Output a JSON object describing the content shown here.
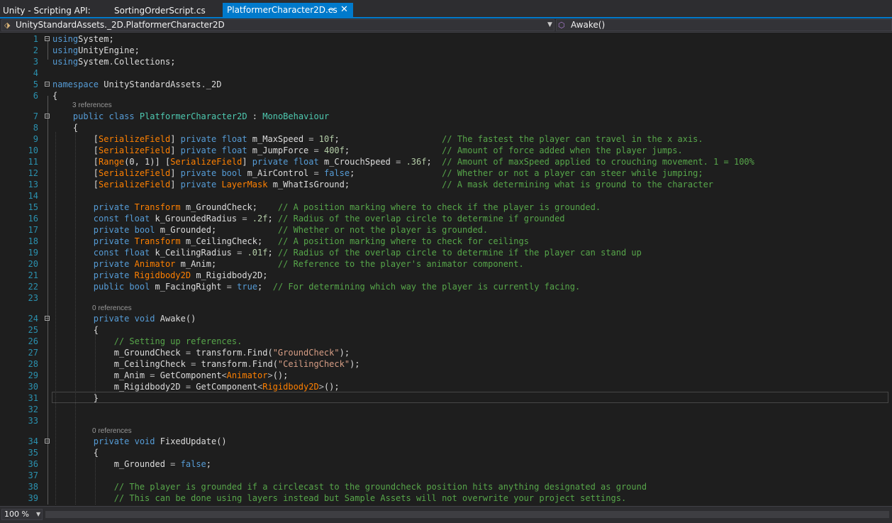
{
  "tabs": [
    {
      "label": "Unity - Scripting API:"
    },
    {
      "label": "SortingOrderScript.cs"
    },
    {
      "label": "PlatformerCharacter2D.cs",
      "active": true,
      "pin_icon": "pin-icon",
      "close_icon": "close-icon"
    }
  ],
  "navbar": {
    "class_scope": "UnityStandardAssets._2D.PlatformerCharacter2D",
    "member_scope": "Awake()",
    "class_icon": "class-icon",
    "method_icon": "method-icon"
  },
  "editor": {
    "references": {
      "r7": "3 references",
      "r24": "0 references",
      "r34": "0 references"
    },
    "lines": [
      {
        "n": "1",
        "tokens": [
          [
            "k",
            "using"
          ],
          [
            "",
            "System;"
          ]
        ]
      },
      {
        "n": "2",
        "tokens": [
          [
            "k",
            "using"
          ],
          [
            "",
            "UnityEngine;"
          ]
        ]
      },
      {
        "n": "3",
        "tokens": [
          [
            "k",
            "using"
          ],
          [
            "",
            "System"
          ],
          [
            "o",
            "."
          ],
          [
            "",
            "Collections;"
          ]
        ]
      },
      {
        "n": "4",
        "tokens": []
      },
      {
        "n": "5",
        "tokens": [
          [
            "k",
            "namespace"
          ],
          [
            "",
            " UnityStandardAssets"
          ],
          [
            "o",
            "."
          ],
          [
            "",
            "_2D"
          ]
        ]
      },
      {
        "n": "6",
        "tokens": [
          [
            "",
            "{"
          ]
        ]
      },
      {
        "n": "7",
        "tokens": [
          [
            "",
            "    "
          ],
          [
            "k",
            "public"
          ],
          [
            "",
            " "
          ],
          [
            "k",
            "class"
          ],
          [
            "",
            " "
          ],
          [
            "t",
            "PlatformerCharacter2D"
          ],
          [
            "",
            " : "
          ],
          [
            "t",
            "MonoBehaviour"
          ]
        ]
      },
      {
        "n": "8",
        "tokens": [
          [
            "",
            "    {"
          ]
        ]
      },
      {
        "n": "9",
        "tokens": [
          [
            "",
            "        ["
          ],
          [
            "a",
            "SerializeField"
          ],
          [
            "",
            "] "
          ],
          [
            "k",
            "private"
          ],
          [
            "",
            " "
          ],
          [
            "k",
            "float"
          ],
          [
            "",
            " m_MaxSpeed "
          ],
          [
            "o",
            "="
          ],
          [
            "",
            " "
          ],
          [
            "n",
            "10f"
          ],
          [
            "",
            ";                    "
          ],
          [
            "c",
            "// The fastest the player can travel in the x axis."
          ]
        ]
      },
      {
        "n": "10",
        "tokens": [
          [
            "",
            "        ["
          ],
          [
            "a",
            "SerializeField"
          ],
          [
            "",
            "] "
          ],
          [
            "k",
            "private"
          ],
          [
            "",
            " "
          ],
          [
            "k",
            "float"
          ],
          [
            "",
            " m_JumpForce "
          ],
          [
            "o",
            "="
          ],
          [
            "",
            " "
          ],
          [
            "n",
            "400f"
          ],
          [
            "",
            ";                  "
          ],
          [
            "c",
            "// Amount of force added when the player jumps."
          ]
        ]
      },
      {
        "n": "11",
        "tokens": [
          [
            "",
            "        ["
          ],
          [
            "a",
            "Range"
          ],
          [
            "",
            "(0, 1)] ["
          ],
          [
            "a",
            "SerializeField"
          ],
          [
            "",
            "] "
          ],
          [
            "k",
            "private"
          ],
          [
            "",
            " "
          ],
          [
            "k",
            "float"
          ],
          [
            "",
            " m_CrouchSpeed "
          ],
          [
            "o",
            "="
          ],
          [
            "",
            " "
          ],
          [
            "n",
            ".36f"
          ],
          [
            "",
            ";  "
          ],
          [
            "c",
            "// Amount of maxSpeed applied to crouching movement. 1 = 100%"
          ]
        ]
      },
      {
        "n": "12",
        "tokens": [
          [
            "",
            "        ["
          ],
          [
            "a",
            "SerializeField"
          ],
          [
            "",
            "] "
          ],
          [
            "k",
            "private"
          ],
          [
            "",
            " "
          ],
          [
            "k",
            "bool"
          ],
          [
            "",
            " m_AirControl "
          ],
          [
            "o",
            "="
          ],
          [
            "",
            " "
          ],
          [
            "k",
            "false"
          ],
          [
            "",
            ";                 "
          ],
          [
            "c",
            "// Whether or not a player can steer while jumping;"
          ]
        ]
      },
      {
        "n": "13",
        "tokens": [
          [
            "",
            "        ["
          ],
          [
            "a",
            "SerializeField"
          ],
          [
            "",
            "] "
          ],
          [
            "k",
            "private"
          ],
          [
            "",
            " "
          ],
          [
            "a",
            "LayerMask"
          ],
          [
            "",
            " m_WhatIsGround;                  "
          ],
          [
            "c",
            "// A mask determining what is ground to the character"
          ]
        ]
      },
      {
        "n": "14",
        "tokens": []
      },
      {
        "n": "15",
        "tokens": [
          [
            "",
            "        "
          ],
          [
            "k",
            "private"
          ],
          [
            "",
            " "
          ],
          [
            "a",
            "Transform"
          ],
          [
            "",
            " m_GroundCheck;    "
          ],
          [
            "c",
            "// A position marking where to check if the player is grounded."
          ]
        ]
      },
      {
        "n": "16",
        "tokens": [
          [
            "",
            "        "
          ],
          [
            "k",
            "const"
          ],
          [
            "",
            " "
          ],
          [
            "k",
            "float"
          ],
          [
            "",
            " k_GroundedRadius "
          ],
          [
            "o",
            "="
          ],
          [
            "",
            " "
          ],
          [
            "n",
            ".2f"
          ],
          [
            "",
            "; "
          ],
          [
            "c",
            "// Radius of the overlap circle to determine if grounded"
          ]
        ]
      },
      {
        "n": "17",
        "tokens": [
          [
            "",
            "        "
          ],
          [
            "k",
            "private"
          ],
          [
            "",
            " "
          ],
          [
            "k",
            "bool"
          ],
          [
            "",
            " m_Grounded;            "
          ],
          [
            "c",
            "// Whether or not the player is grounded."
          ]
        ]
      },
      {
        "n": "18",
        "tokens": [
          [
            "",
            "        "
          ],
          [
            "k",
            "private"
          ],
          [
            "",
            " "
          ],
          [
            "a",
            "Transform"
          ],
          [
            "",
            " m_CeilingCheck;   "
          ],
          [
            "c",
            "// A position marking where to check for ceilings"
          ]
        ]
      },
      {
        "n": "19",
        "tokens": [
          [
            "",
            "        "
          ],
          [
            "k",
            "const"
          ],
          [
            "",
            " "
          ],
          [
            "k",
            "float"
          ],
          [
            "",
            " k_CeilingRadius "
          ],
          [
            "o",
            "="
          ],
          [
            "",
            " "
          ],
          [
            "n",
            ".01f"
          ],
          [
            "",
            "; "
          ],
          [
            "c",
            "// Radius of the overlap circle to determine if the player can stand up"
          ]
        ]
      },
      {
        "n": "20",
        "tokens": [
          [
            "",
            "        "
          ],
          [
            "k",
            "private"
          ],
          [
            "",
            " "
          ],
          [
            "a",
            "Animator"
          ],
          [
            "",
            " m_Anim;            "
          ],
          [
            "c",
            "// Reference to the player's animator component."
          ]
        ]
      },
      {
        "n": "21",
        "tokens": [
          [
            "",
            "        "
          ],
          [
            "k",
            "private"
          ],
          [
            "",
            " "
          ],
          [
            "a",
            "Rigidbody2D"
          ],
          [
            "",
            " m_Rigidbody2D;"
          ]
        ]
      },
      {
        "n": "22",
        "tokens": [
          [
            "",
            "        "
          ],
          [
            "k",
            "public"
          ],
          [
            "",
            " "
          ],
          [
            "k",
            "bool"
          ],
          [
            "",
            " m_FacingRight "
          ],
          [
            "o",
            "="
          ],
          [
            "",
            " "
          ],
          [
            "k",
            "true"
          ],
          [
            "",
            ";  "
          ],
          [
            "c",
            "// For determining which way the player is currently facing."
          ]
        ]
      },
      {
        "n": "23",
        "tokens": []
      },
      {
        "n": "24",
        "tokens": [
          [
            "",
            "        "
          ],
          [
            "k",
            "private"
          ],
          [
            "",
            " "
          ],
          [
            "k",
            "void"
          ],
          [
            "",
            " Awake()"
          ]
        ]
      },
      {
        "n": "25",
        "tokens": [
          [
            "",
            "        {"
          ]
        ]
      },
      {
        "n": "26",
        "tokens": [
          [
            "",
            "            "
          ],
          [
            "c",
            "// Setting up references."
          ]
        ]
      },
      {
        "n": "27",
        "tokens": [
          [
            "",
            "            m_GroundCheck "
          ],
          [
            "o",
            "="
          ],
          [
            "",
            " transform"
          ],
          [
            "o",
            "."
          ],
          [
            "",
            "Find("
          ],
          [
            "s",
            "\"GroundCheck\""
          ],
          [
            "",
            ");"
          ]
        ]
      },
      {
        "n": "28",
        "tokens": [
          [
            "",
            "            m_CeilingCheck "
          ],
          [
            "o",
            "="
          ],
          [
            "",
            " transform"
          ],
          [
            "o",
            "."
          ],
          [
            "",
            "Find("
          ],
          [
            "s",
            "\"CeilingCheck\""
          ],
          [
            "",
            ");"
          ]
        ]
      },
      {
        "n": "29",
        "tokens": [
          [
            "",
            "            m_Anim "
          ],
          [
            "o",
            "="
          ],
          [
            "",
            " GetComponent"
          ],
          [
            "o",
            "<"
          ],
          [
            "a",
            "Animator"
          ],
          [
            "o",
            ">"
          ],
          [
            "",
            "();"
          ]
        ]
      },
      {
        "n": "30",
        "tokens": [
          [
            "",
            "            m_Rigidbody2D "
          ],
          [
            "o",
            "="
          ],
          [
            "",
            " GetComponent"
          ],
          [
            "o",
            "<"
          ],
          [
            "a",
            "Rigidbody2D"
          ],
          [
            "o",
            ">"
          ],
          [
            "",
            "();"
          ]
        ]
      },
      {
        "n": "31",
        "tokens": [
          [
            "",
            "        }"
          ]
        ]
      },
      {
        "n": "32",
        "tokens": []
      },
      {
        "n": "33",
        "tokens": []
      },
      {
        "n": "34",
        "tokens": [
          [
            "",
            "        "
          ],
          [
            "k",
            "private"
          ],
          [
            "",
            " "
          ],
          [
            "k",
            "void"
          ],
          [
            "",
            " FixedUpdate()"
          ]
        ]
      },
      {
        "n": "35",
        "tokens": [
          [
            "",
            "        {"
          ]
        ]
      },
      {
        "n": "36",
        "tokens": [
          [
            "",
            "            m_Grounded "
          ],
          [
            "o",
            "="
          ],
          [
            "",
            " "
          ],
          [
            "k",
            "false"
          ],
          [
            "",
            ";"
          ]
        ]
      },
      {
        "n": "37",
        "tokens": []
      },
      {
        "n": "38",
        "tokens": [
          [
            "",
            "            "
          ],
          [
            "c",
            "// The player is grounded if a circlecast to the groundcheck position hits anything designated as ground"
          ]
        ]
      },
      {
        "n": "39",
        "tokens": [
          [
            "",
            "            "
          ],
          [
            "c",
            "// This can be done using layers instead but Sample Assets will not overwrite your project settings."
          ]
        ]
      }
    ]
  },
  "statusbar": {
    "zoom": "100 %"
  },
  "colors": {
    "keyword": "#569cd6",
    "type": "#4ec9b0",
    "attribute": "#ff8000",
    "number": "#b5cea8",
    "comment": "#57a64a",
    "string": "#d69d85",
    "accent": "#007acc"
  }
}
